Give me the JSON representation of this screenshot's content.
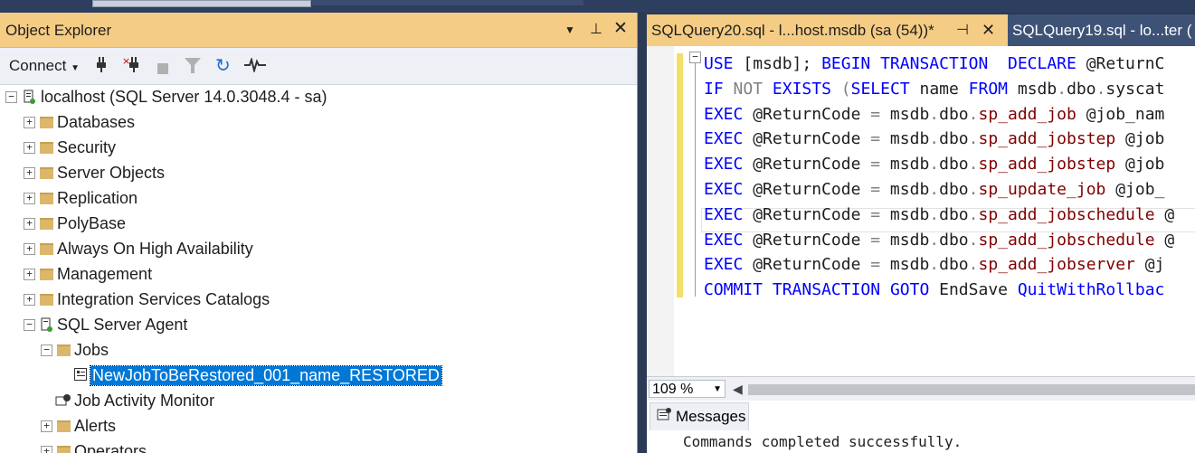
{
  "object_explorer": {
    "title": "Object Explorer",
    "toolbar": {
      "connect_label": "Connect"
    },
    "server": {
      "label": "localhost (SQL Server 14.0.3048.4 - sa)"
    },
    "nodes": [
      {
        "label": "Databases"
      },
      {
        "label": "Security"
      },
      {
        "label": "Server Objects"
      },
      {
        "label": "Replication"
      },
      {
        "label": "PolyBase"
      },
      {
        "label": "Always On High Availability"
      },
      {
        "label": "Management"
      },
      {
        "label": "Integration Services Catalogs"
      },
      {
        "label": "SQL Server Agent"
      }
    ],
    "agent_children": {
      "jobs": "Jobs",
      "selected_job": "NewJobToBeRestored_001_name_RESTORED",
      "job_activity_monitor": "Job Activity Monitor",
      "alerts": "Alerts",
      "operators": "Operators"
    }
  },
  "editor": {
    "tabs": [
      {
        "label": "SQLQuery20.sql - l...host.msdb (sa (54))*",
        "active": true
      },
      {
        "label": "SQLQuery19.sql - lo...ter (",
        "active": false
      }
    ],
    "code_lines": [
      "USE [msdb]; BEGIN TRANSACTION  DECLARE @ReturnC",
      "IF NOT EXISTS (SELECT name FROM msdb.dbo.syscat",
      "EXEC @ReturnCode = msdb.dbo.sp_add_job @job_nam",
      "EXEC @ReturnCode = msdb.dbo.sp_add_jobstep @job",
      "EXEC @ReturnCode = msdb.dbo.sp_add_jobstep @job",
      "EXEC @ReturnCode = msdb.dbo.sp_update_job @job_",
      "EXEC @ReturnCode = msdb.dbo.sp_add_jobschedule @",
      "EXEC @ReturnCode = msdb.dbo.sp_add_jobschedule @",
      "EXEC @ReturnCode = msdb.dbo.sp_add_jobserver @j",
      "COMMIT TRANSACTION GOTO EndSave QuitWithRollbac"
    ],
    "zoom": "109 %"
  },
  "messages": {
    "tab_label": "Messages",
    "text": "Commands completed successfully."
  },
  "colors": {
    "accent": "#f5cc84",
    "selection": "#0078d7",
    "keyword": "#0000ff",
    "stored_proc": "#800000"
  }
}
